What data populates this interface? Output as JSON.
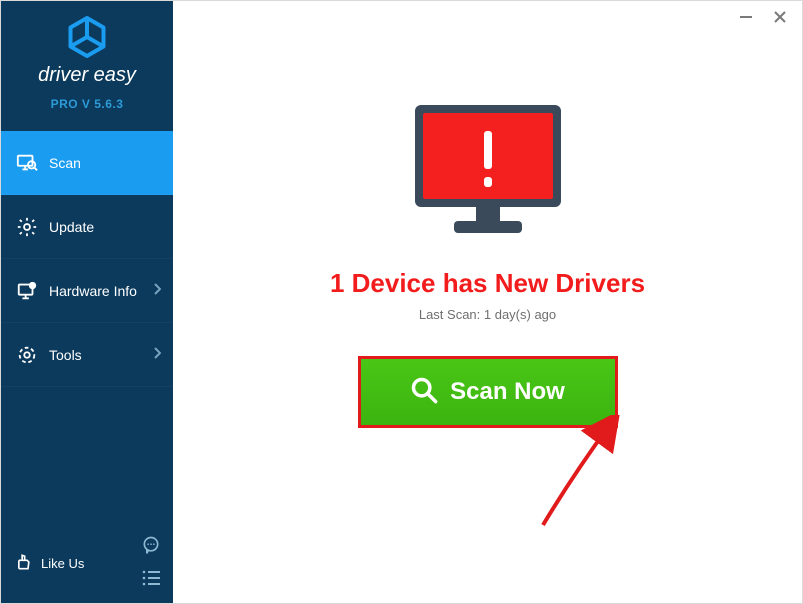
{
  "brand": {
    "name": "driver easy",
    "version": "PRO V 5.6.3"
  },
  "sidebar": {
    "items": [
      {
        "label": "Scan",
        "icon": "scan",
        "active": true,
        "hasChevron": false
      },
      {
        "label": "Update",
        "icon": "update",
        "active": false,
        "hasChevron": false
      },
      {
        "label": "Hardware Info",
        "icon": "hardware",
        "active": false,
        "hasChevron": true
      },
      {
        "label": "Tools",
        "icon": "tools",
        "active": false,
        "hasChevron": true
      }
    ],
    "likeLabel": "Like Us"
  },
  "main": {
    "headline": "1 Device has New Drivers",
    "subline": "Last Scan: 1 day(s) ago",
    "scanButtonLabel": "Scan Now"
  },
  "colors": {
    "sidebarBg": "#0b3a5c",
    "active": "#1a9cf0",
    "danger": "#f21c1c",
    "scanGreen": "#3cb40f"
  }
}
